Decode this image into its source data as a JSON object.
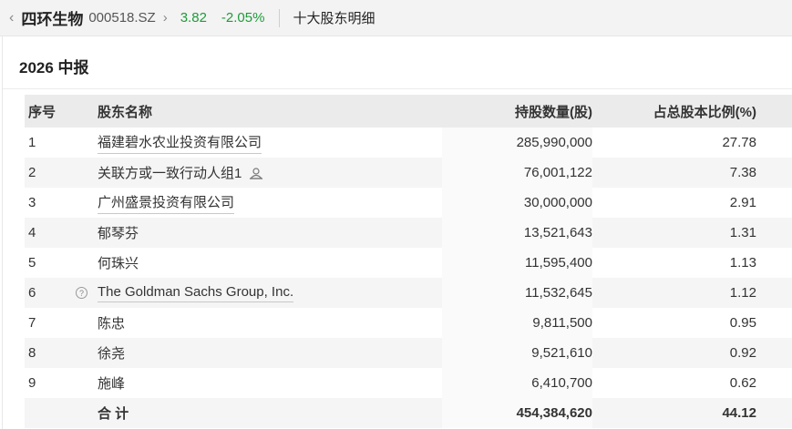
{
  "header": {
    "back_icon": "chevron-left-icon",
    "stock_name": "四环生物",
    "stock_code": "000518.SZ",
    "chevron": "›",
    "price": "3.82",
    "change_pct": "-2.05%",
    "section_title": "十大股东明细",
    "colors": {
      "down": "#1e9b3a"
    }
  },
  "period": "2026 中报",
  "table": {
    "columns": [
      "序号",
      "股东名称",
      "持股数量(股)",
      "占总股本比例(%)"
    ],
    "rows": [
      {
        "idx": "1",
        "name": "福建碧水农业投资有限公司",
        "shares": "285,990,000",
        "ratio": "27.78",
        "link": true
      },
      {
        "idx": "2",
        "name": "关联方或一致行动人组1",
        "shares": "76,001,122",
        "ratio": "7.38",
        "link": false,
        "group_icon": "group-icon"
      },
      {
        "idx": "3",
        "name": "广州盛景投资有限公司",
        "shares": "30,000,000",
        "ratio": "2.91",
        "link": true
      },
      {
        "idx": "4",
        "name": "郁琴芬",
        "shares": "13,521,643",
        "ratio": "1.31",
        "link": false
      },
      {
        "idx": "5",
        "name": "何珠兴",
        "shares": "11,595,400",
        "ratio": "1.13",
        "link": false
      },
      {
        "idx": "6",
        "name": "The Goldman Sachs Group, Inc.",
        "shares": "11,532,645",
        "ratio": "1.12",
        "link": true,
        "help_icon": "help-icon"
      },
      {
        "idx": "7",
        "name": "陈忠",
        "shares": "9,811,500",
        "ratio": "0.95",
        "link": false
      },
      {
        "idx": "8",
        "name": "徐尧",
        "shares": "9,521,610",
        "ratio": "0.92",
        "link": false
      },
      {
        "idx": "9",
        "name": "施峰",
        "shares": "6,410,700",
        "ratio": "0.62",
        "link": false
      }
    ],
    "total": {
      "label": "合 计",
      "shares": "454,384,620",
      "ratio": "44.12"
    }
  }
}
